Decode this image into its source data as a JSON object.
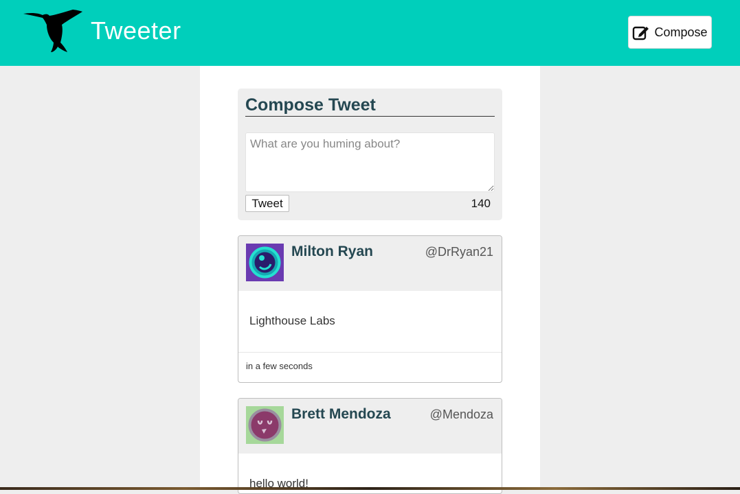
{
  "header": {
    "brand": "Tweeter",
    "compose_label": "Compose"
  },
  "compose": {
    "title": "Compose Tweet",
    "placeholder": "What are you huming about?",
    "value": "",
    "submit_label": "Tweet",
    "counter": "140"
  },
  "tweets": [
    {
      "name": "Milton Ryan",
      "handle": "@DrRyan21",
      "content": "Lighthouse Labs",
      "time": "in a few seconds",
      "avatar_bg": "#6a3bb1",
      "avatar_fg": "#25e0d0"
    },
    {
      "name": "Brett Mendoza",
      "handle": "@Mendoza",
      "content": "hello world!",
      "time": "",
      "avatar_bg": "#a6d89a",
      "avatar_fg": "#8b3a6a"
    }
  ]
}
